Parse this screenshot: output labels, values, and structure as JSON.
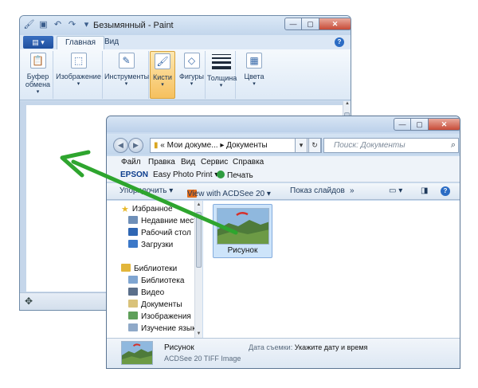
{
  "paint": {
    "title": "Безымянный - Paint",
    "tabs": [
      "Главная",
      "Вид"
    ],
    "ribbon": {
      "clipboard": "Буфер обмена",
      "image": "Изображение",
      "tools": "Инструменты",
      "brushes": "Кисти",
      "shapes": "Фигуры",
      "thickness": "Толщина",
      "colors": "Цвета"
    },
    "qat_icons": [
      "paint-app-icon",
      "save-icon",
      "undo-icon",
      "redo-icon"
    ]
  },
  "explorer": {
    "address": {
      "prefix": "«",
      "part1": "Мои докуме...",
      "sep": "▸",
      "part2": "Документы"
    },
    "search_placeholder": "Поиск: Документы",
    "menu": [
      "Файл",
      "Правка",
      "Вид",
      "Сервис",
      "Справка"
    ],
    "epson": {
      "brand": "EPSON",
      "easy_photo_print": "Easy Photo Print ▾",
      "print": "Печать"
    },
    "toolbar": {
      "organize": "Упорядочить ▾",
      "acdsee": "View with ACDSee 20 ▾",
      "slideshow": "Показ слайдов",
      "more": "»"
    },
    "nav": {
      "favorites": "Избранное",
      "recent": "Недавние места",
      "desktop": "Рабочий стол",
      "downloads": "Загрузки",
      "libraries": "Библиотеки",
      "library": "Библиотека",
      "video": "Видео",
      "documents": "Документы",
      "images": "Изображения",
      "language": "Изучение языка"
    },
    "file": {
      "name": "Рисунок",
      "type": "ACDSee 20 TIFF Image",
      "date_label": "Дата съемки:",
      "date_value": "Укажите дату и время"
    }
  },
  "colors": {
    "arrow": "#2ea52e",
    "selected_ribbon": "#f6c05e",
    "close_button": "#c74b37"
  }
}
